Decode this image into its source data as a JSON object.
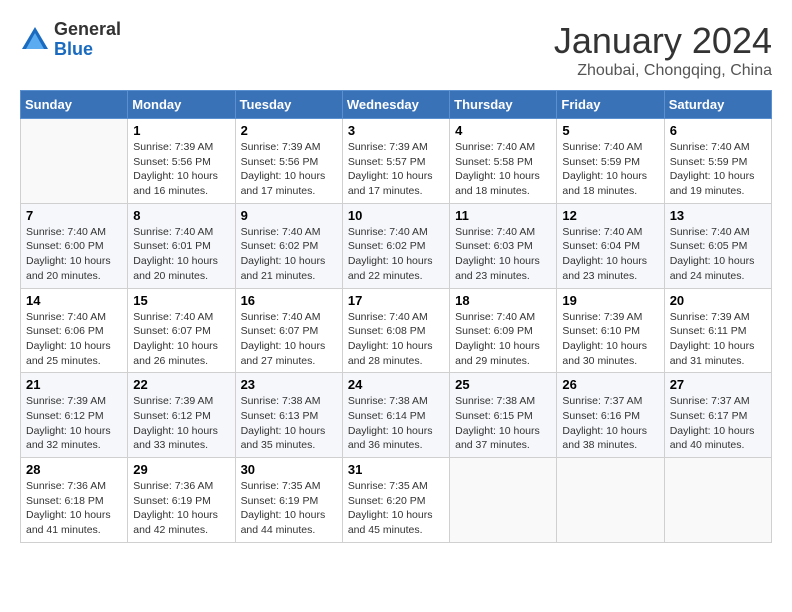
{
  "logo": {
    "general": "General",
    "blue": "Blue"
  },
  "title": "January 2024",
  "subtitle": "Zhoubai, Chongqing, China",
  "headers": [
    "Sunday",
    "Monday",
    "Tuesday",
    "Wednesday",
    "Thursday",
    "Friday",
    "Saturday"
  ],
  "weeks": [
    [
      {
        "day": "",
        "info": ""
      },
      {
        "day": "1",
        "info": "Sunrise: 7:39 AM\nSunset: 5:56 PM\nDaylight: 10 hours\nand 16 minutes."
      },
      {
        "day": "2",
        "info": "Sunrise: 7:39 AM\nSunset: 5:56 PM\nDaylight: 10 hours\nand 17 minutes."
      },
      {
        "day": "3",
        "info": "Sunrise: 7:39 AM\nSunset: 5:57 PM\nDaylight: 10 hours\nand 17 minutes."
      },
      {
        "day": "4",
        "info": "Sunrise: 7:40 AM\nSunset: 5:58 PM\nDaylight: 10 hours\nand 18 minutes."
      },
      {
        "day": "5",
        "info": "Sunrise: 7:40 AM\nSunset: 5:59 PM\nDaylight: 10 hours\nand 18 minutes."
      },
      {
        "day": "6",
        "info": "Sunrise: 7:40 AM\nSunset: 5:59 PM\nDaylight: 10 hours\nand 19 minutes."
      }
    ],
    [
      {
        "day": "7",
        "info": "Sunrise: 7:40 AM\nSunset: 6:00 PM\nDaylight: 10 hours\nand 20 minutes."
      },
      {
        "day": "8",
        "info": "Sunrise: 7:40 AM\nSunset: 6:01 PM\nDaylight: 10 hours\nand 20 minutes."
      },
      {
        "day": "9",
        "info": "Sunrise: 7:40 AM\nSunset: 6:02 PM\nDaylight: 10 hours\nand 21 minutes."
      },
      {
        "day": "10",
        "info": "Sunrise: 7:40 AM\nSunset: 6:02 PM\nDaylight: 10 hours\nand 22 minutes."
      },
      {
        "day": "11",
        "info": "Sunrise: 7:40 AM\nSunset: 6:03 PM\nDaylight: 10 hours\nand 23 minutes."
      },
      {
        "day": "12",
        "info": "Sunrise: 7:40 AM\nSunset: 6:04 PM\nDaylight: 10 hours\nand 23 minutes."
      },
      {
        "day": "13",
        "info": "Sunrise: 7:40 AM\nSunset: 6:05 PM\nDaylight: 10 hours\nand 24 minutes."
      }
    ],
    [
      {
        "day": "14",
        "info": "Sunrise: 7:40 AM\nSunset: 6:06 PM\nDaylight: 10 hours\nand 25 minutes."
      },
      {
        "day": "15",
        "info": "Sunrise: 7:40 AM\nSunset: 6:07 PM\nDaylight: 10 hours\nand 26 minutes."
      },
      {
        "day": "16",
        "info": "Sunrise: 7:40 AM\nSunset: 6:07 PM\nDaylight: 10 hours\nand 27 minutes."
      },
      {
        "day": "17",
        "info": "Sunrise: 7:40 AM\nSunset: 6:08 PM\nDaylight: 10 hours\nand 28 minutes."
      },
      {
        "day": "18",
        "info": "Sunrise: 7:40 AM\nSunset: 6:09 PM\nDaylight: 10 hours\nand 29 minutes."
      },
      {
        "day": "19",
        "info": "Sunrise: 7:39 AM\nSunset: 6:10 PM\nDaylight: 10 hours\nand 30 minutes."
      },
      {
        "day": "20",
        "info": "Sunrise: 7:39 AM\nSunset: 6:11 PM\nDaylight: 10 hours\nand 31 minutes."
      }
    ],
    [
      {
        "day": "21",
        "info": "Sunrise: 7:39 AM\nSunset: 6:12 PM\nDaylight: 10 hours\nand 32 minutes."
      },
      {
        "day": "22",
        "info": "Sunrise: 7:39 AM\nSunset: 6:12 PM\nDaylight: 10 hours\nand 33 minutes."
      },
      {
        "day": "23",
        "info": "Sunrise: 7:38 AM\nSunset: 6:13 PM\nDaylight: 10 hours\nand 35 minutes."
      },
      {
        "day": "24",
        "info": "Sunrise: 7:38 AM\nSunset: 6:14 PM\nDaylight: 10 hours\nand 36 minutes."
      },
      {
        "day": "25",
        "info": "Sunrise: 7:38 AM\nSunset: 6:15 PM\nDaylight: 10 hours\nand 37 minutes."
      },
      {
        "day": "26",
        "info": "Sunrise: 7:37 AM\nSunset: 6:16 PM\nDaylight: 10 hours\nand 38 minutes."
      },
      {
        "day": "27",
        "info": "Sunrise: 7:37 AM\nSunset: 6:17 PM\nDaylight: 10 hours\nand 40 minutes."
      }
    ],
    [
      {
        "day": "28",
        "info": "Sunrise: 7:36 AM\nSunset: 6:18 PM\nDaylight: 10 hours\nand 41 minutes."
      },
      {
        "day": "29",
        "info": "Sunrise: 7:36 AM\nSunset: 6:19 PM\nDaylight: 10 hours\nand 42 minutes."
      },
      {
        "day": "30",
        "info": "Sunrise: 7:35 AM\nSunset: 6:19 PM\nDaylight: 10 hours\nand 44 minutes."
      },
      {
        "day": "31",
        "info": "Sunrise: 7:35 AM\nSunset: 6:20 PM\nDaylight: 10 hours\nand 45 minutes."
      },
      {
        "day": "",
        "info": ""
      },
      {
        "day": "",
        "info": ""
      },
      {
        "day": "",
        "info": ""
      }
    ]
  ]
}
